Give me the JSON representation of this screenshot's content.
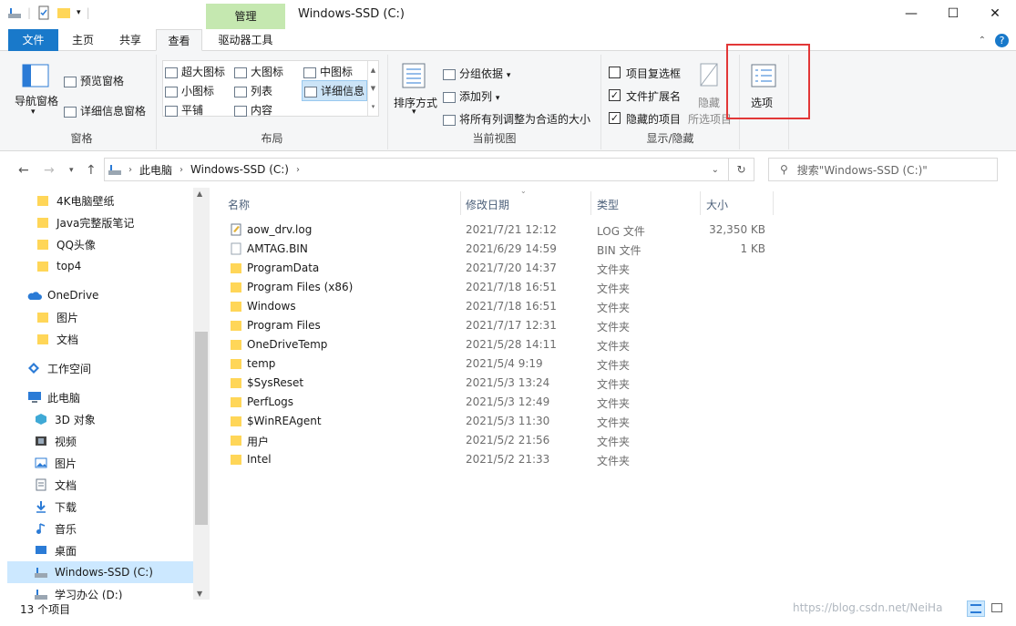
{
  "titlebar": {
    "context_tab": "管理",
    "title": "Windows-SSD (C:)",
    "minimize": "—",
    "maximize": "☐",
    "close": "✕"
  },
  "tabs": {
    "file": "文件",
    "home": "主页",
    "share": "共享",
    "view": "查看",
    "drive_tools": "驱动器工具"
  },
  "ribbon": {
    "panes": {
      "nav_pane": "导航窗格",
      "preview_pane": "预览窗格",
      "details_pane": "详细信息窗格",
      "label": "窗格"
    },
    "layout": {
      "extra_large": "超大图标",
      "large": "大图标",
      "medium": "中图标",
      "small": "小图标",
      "list": "列表",
      "details": "详细信息",
      "tiles": "平铺",
      "content": "内容",
      "label": "布局"
    },
    "current_view": {
      "sort_by": "排序方式",
      "group_by": "分组依据",
      "add_column": "添加列",
      "size_all": "将所有列调整为合适的大小",
      "label": "当前视图"
    },
    "show_hide": {
      "item_checkboxes": "项目复选框",
      "file_extensions": "文件扩展名",
      "hidden_items": "隐藏的项目",
      "hide_selected_1": "隐藏",
      "hide_selected_2": "所选项目",
      "label": "显示/隐藏",
      "item_checkboxes_checked": false,
      "file_extensions_checked": true,
      "hidden_items_checked": true
    },
    "options": "选项"
  },
  "address": {
    "path": [
      "此电脑",
      "Windows-SSD (C:)"
    ],
    "search_placeholder": "搜索\"Windows-SSD (C:)\""
  },
  "navpane": {
    "items": [
      {
        "label": "4K电脑壁纸",
        "icon": "folder-icon"
      },
      {
        "label": "Java完整版笔记",
        "icon": "folder-icon"
      },
      {
        "label": "QQ头像",
        "icon": "folder-icon"
      },
      {
        "label": "top4",
        "icon": "folder-icon"
      },
      {
        "label": "OneDrive",
        "icon": "cloud-icon"
      },
      {
        "label": "图片",
        "icon": "folder-icon"
      },
      {
        "label": "文档",
        "icon": "folder-icon"
      },
      {
        "label": "工作空间",
        "icon": "workspace-icon"
      },
      {
        "label": "此电脑",
        "icon": "computer-icon"
      },
      {
        "label": "3D 对象",
        "icon": "cube-icon"
      },
      {
        "label": "视频",
        "icon": "video-icon"
      },
      {
        "label": "图片",
        "icon": "picture-icon"
      },
      {
        "label": "文档",
        "icon": "document-icon"
      },
      {
        "label": "下载",
        "icon": "download-icon"
      },
      {
        "label": "音乐",
        "icon": "music-icon"
      },
      {
        "label": "桌面",
        "icon": "desktop-icon"
      },
      {
        "label": "Windows-SSD (C:)",
        "icon": "drive-icon"
      },
      {
        "label": "学习办公 (D:)",
        "icon": "drive-icon"
      }
    ]
  },
  "columns": {
    "name": "名称",
    "date": "修改日期",
    "type": "类型",
    "size": "大小"
  },
  "files": [
    {
      "name": "aow_drv.log",
      "date": "2021/7/21 12:12",
      "type": "LOG 文件",
      "size": "32,350 KB",
      "icon": "log-file-icon"
    },
    {
      "name": "AMTAG.BIN",
      "date": "2021/6/29 14:59",
      "type": "BIN 文件",
      "size": "1 KB",
      "icon": "file-icon"
    },
    {
      "name": "ProgramData",
      "date": "2021/7/20 14:37",
      "type": "文件夹",
      "size": "",
      "icon": "folder-icon"
    },
    {
      "name": "Program Files (x86)",
      "date": "2021/7/18 16:51",
      "type": "文件夹",
      "size": "",
      "icon": "folder-icon"
    },
    {
      "name": "Windows",
      "date": "2021/7/18 16:51",
      "type": "文件夹",
      "size": "",
      "icon": "folder-icon"
    },
    {
      "name": "Program Files",
      "date": "2021/7/17 12:31",
      "type": "文件夹",
      "size": "",
      "icon": "folder-icon"
    },
    {
      "name": "OneDriveTemp",
      "date": "2021/5/28 14:11",
      "type": "文件夹",
      "size": "",
      "icon": "folder-icon"
    },
    {
      "name": "temp",
      "date": "2021/5/4 9:19",
      "type": "文件夹",
      "size": "",
      "icon": "folder-icon"
    },
    {
      "name": "$SysReset",
      "date": "2021/5/3 13:24",
      "type": "文件夹",
      "size": "",
      "icon": "folder-icon"
    },
    {
      "name": "PerfLogs",
      "date": "2021/5/3 12:49",
      "type": "文件夹",
      "size": "",
      "icon": "folder-icon"
    },
    {
      "name": "$WinREAgent",
      "date": "2021/5/3 11:30",
      "type": "文件夹",
      "size": "",
      "icon": "folder-icon"
    },
    {
      "name": "用户",
      "date": "2021/5/2 21:56",
      "type": "文件夹",
      "size": "",
      "icon": "folder-icon"
    },
    {
      "name": "Intel",
      "date": "2021/5/2 21:33",
      "type": "文件夹",
      "size": "",
      "icon": "folder-icon"
    }
  ],
  "status": {
    "count": "13 个项目",
    "watermark": "https://blog.csdn.net/NeiHa"
  }
}
